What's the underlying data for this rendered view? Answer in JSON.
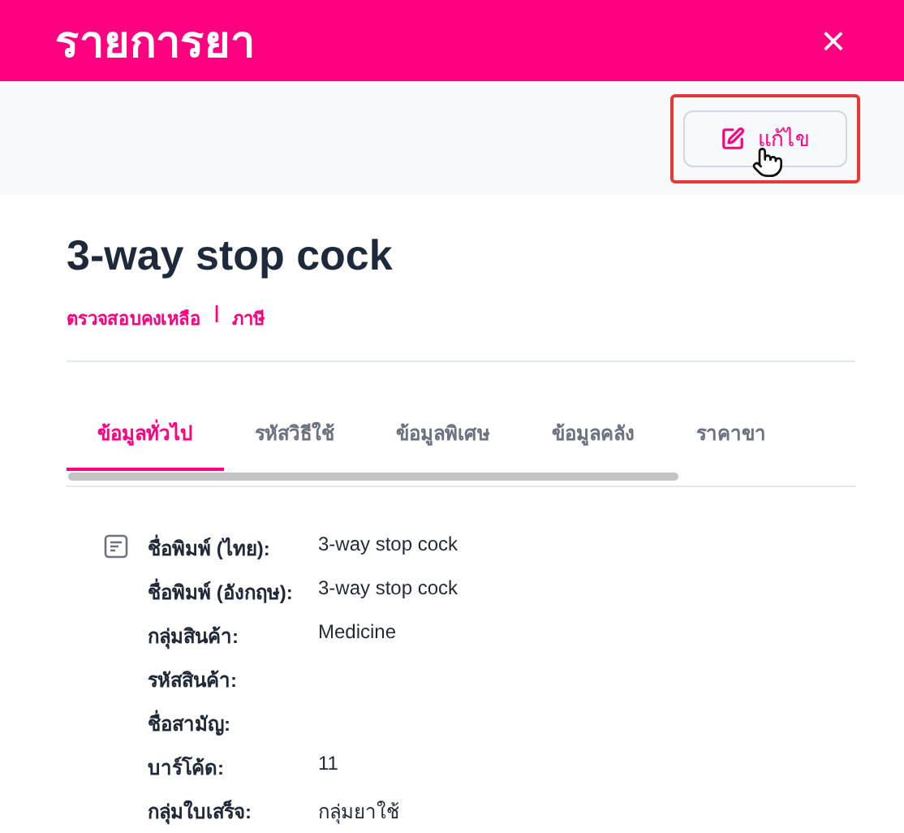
{
  "window": {
    "title": "รายการยา",
    "close": "×"
  },
  "toolbar": {
    "edit_button": "แก้ไข"
  },
  "product": {
    "name": "3-way stop cock",
    "links": [
      "ตรวจสอบคงเหลือ",
      "ภาษี"
    ],
    "separator": "|"
  },
  "tabs": [
    {
      "label": "ข้อมูลทั่วไป",
      "selected": true
    },
    {
      "label": "รหัสวิธีใช้",
      "selected": false
    },
    {
      "label": "ข้อมูลพิเศษ",
      "selected": false
    },
    {
      "label": "ข้อมูลคลัง",
      "selected": false
    },
    {
      "label": "ราคาขา",
      "selected": false
    }
  ],
  "details": [
    {
      "label": "ชื่อพิมพ์ (ไทย):",
      "value": "3-way stop cock"
    },
    {
      "label": "ชื่อพิมพ์ (อังกฤษ):",
      "value": "3-way stop cock"
    },
    {
      "label": "กลุ่มสินค้า:",
      "value": "Medicine"
    },
    {
      "label": "รหัสสินค้า:"
    },
    {
      "label": "ชื่อสามัญ:"
    },
    {
      "label": "บาร์โค้ด:",
      "value": "11"
    },
    {
      "label": "กลุ่มใบเสร็จ:",
      "value": "กลุ่มยาใช้"
    }
  ]
}
